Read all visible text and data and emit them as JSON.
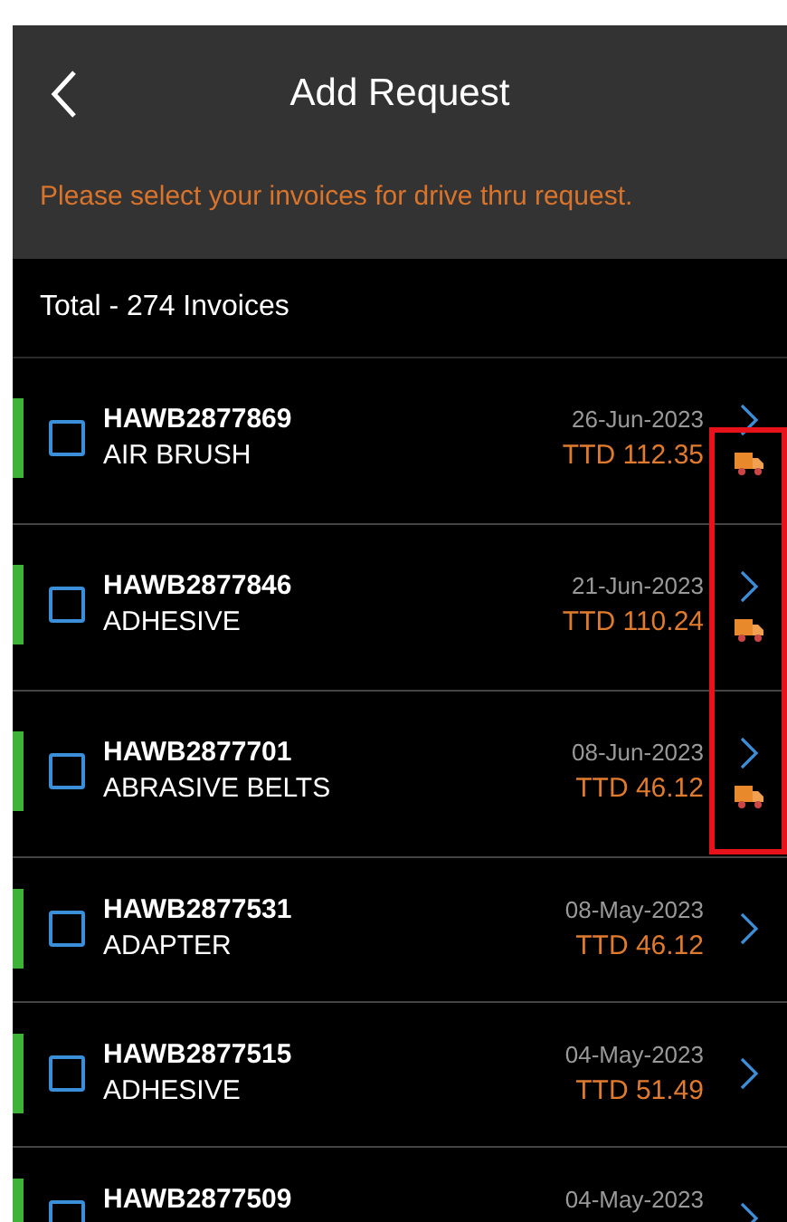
{
  "header": {
    "title": "Add Request"
  },
  "notice": "Please select your invoices for drive thru request.",
  "total": "Total - 274 Invoices",
  "invoices": [
    {
      "id": "HAWB2877869",
      "name": "AIR BRUSH",
      "date": "26-Jun-2023",
      "amount": "TTD 112.35",
      "checked": false,
      "delivery": true
    },
    {
      "id": "HAWB2877846",
      "name": "ADHESIVE",
      "date": "21-Jun-2023",
      "amount": "TTD 110.24",
      "checked": false,
      "delivery": true
    },
    {
      "id": "HAWB2877701",
      "name": "ABRASIVE BELTS",
      "date": "08-Jun-2023",
      "amount": "TTD 46.12",
      "checked": false,
      "delivery": true
    },
    {
      "id": "HAWB2877531",
      "name": "ADAPTER",
      "date": "08-May-2023",
      "amount": "TTD 46.12",
      "checked": false,
      "delivery": false
    },
    {
      "id": "HAWB2877515",
      "name": "ADHESIVE",
      "date": "04-May-2023",
      "amount": "TTD 51.49",
      "checked": false,
      "delivery": false
    },
    {
      "id": "HAWB2877509",
      "date": "04-May-2023",
      "checked": false,
      "delivery": false
    }
  ],
  "highlight": {
    "shown": true
  }
}
